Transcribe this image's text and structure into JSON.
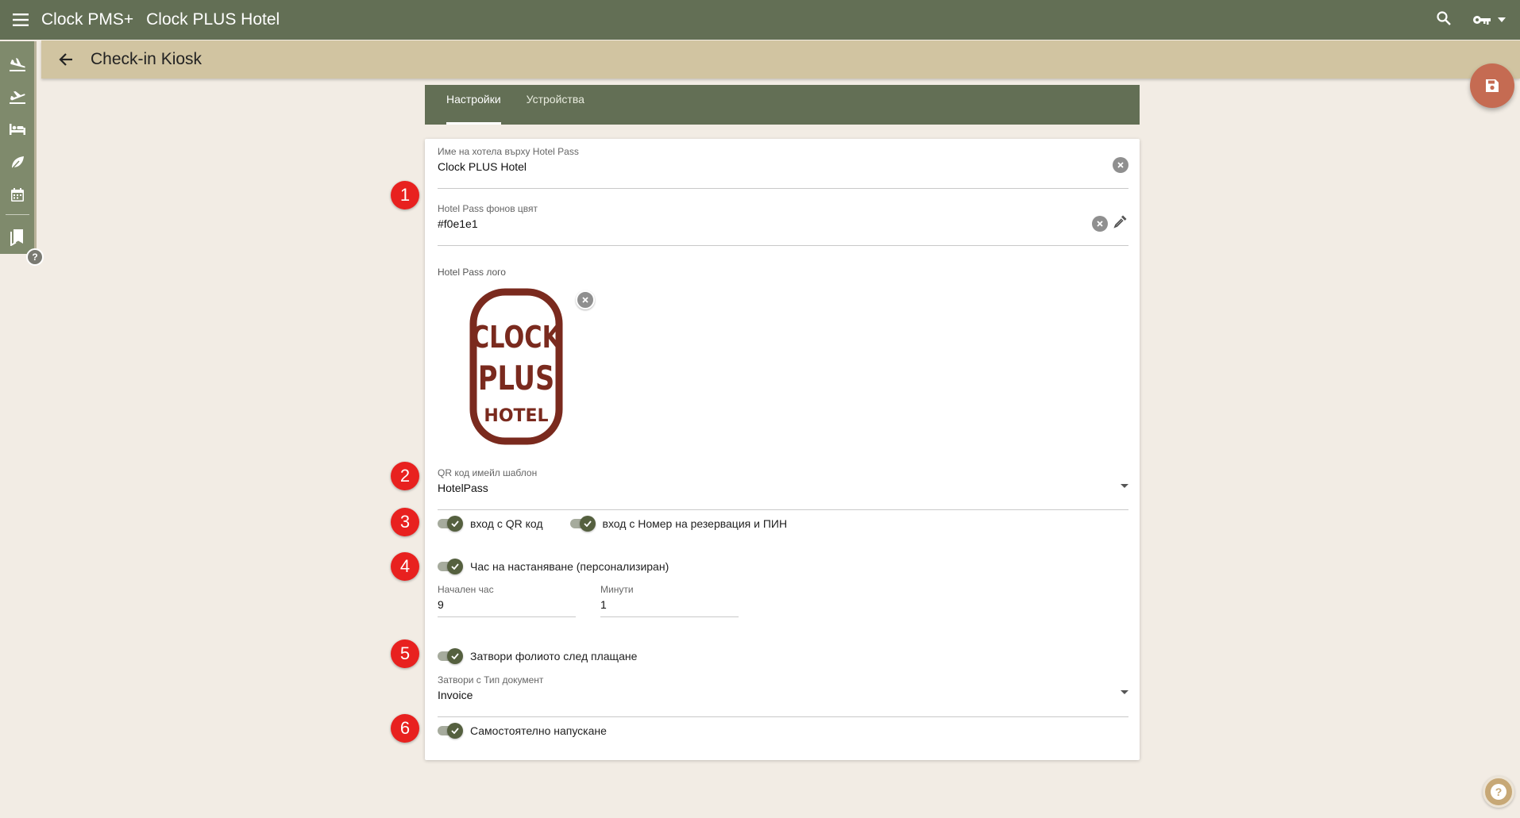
{
  "app": {
    "product_name": "Clock PMS+",
    "hotel_name": "Clock PLUS Hotel"
  },
  "page": {
    "title": "Check-in Kiosk"
  },
  "tabs": [
    {
      "label": "Настройки",
      "active": true
    },
    {
      "label": "Устройства",
      "active": false
    }
  ],
  "form": {
    "hotel_name_field": {
      "label": "Име на хотела върху Hotel Pass",
      "value": "Clock PLUS Hotel"
    },
    "bg_color_field": {
      "label": "Hotel Pass фонов цвят",
      "value": "#f0e1e1"
    },
    "logo": {
      "label": "Hotel Pass лого",
      "lines": [
        "CLOCK",
        "PLUS",
        "HOTEL"
      ]
    },
    "qr_template_field": {
      "label": "QR код имейл шаблон",
      "value": "HotelPass"
    },
    "toggle_qr_login": {
      "label": "вход с QR код",
      "on": true
    },
    "toggle_pin_login": {
      "label": "вход с Номер на резервация и ПИН",
      "on": true
    },
    "toggle_custom_checkin": {
      "label": "Час на настаняване (персонализиран)",
      "on": true
    },
    "start_hour_field": {
      "label": "Начален час",
      "value": "9"
    },
    "minutes_field": {
      "label": "Минути",
      "value": "1"
    },
    "toggle_close_folio": {
      "label": "Затвори фолиото след плащане",
      "on": true
    },
    "close_doc_type_field": {
      "label": "Затвори с Тип документ",
      "value": "Invoice"
    },
    "toggle_self_checkout": {
      "label": "Самостоятелно напускане",
      "on": true
    }
  },
  "markers": [
    "1",
    "2",
    "3",
    "4",
    "5",
    "6"
  ],
  "colors": {
    "appbar": "#636f55",
    "subbar": "#d1c4a1",
    "accent_fab": "#c56b52",
    "logo_brown": "#7a2a1e",
    "marker_red": "#e8211f"
  },
  "icons": {
    "menu": "menu-icon",
    "search": "search-icon",
    "key": "key-icon",
    "back": "arrow-back-icon",
    "save": "save-icon",
    "eyedropper": "eyedropper-icon"
  }
}
